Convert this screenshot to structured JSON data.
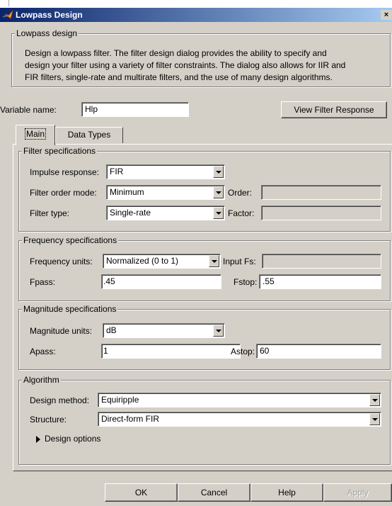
{
  "window": {
    "title": "Lowpass Design",
    "close_glyph": "×",
    "title_icon": "matlab-icon"
  },
  "intro": {
    "group_label": "Lowpass design",
    "description_lines": [
      "Design a lowpass filter.  The filter design dialog provides the ability to specify and",
      "design your filter using a variety of filter constraints.  The dialog also allows for IIR and",
      "FIR filters, single-rate and multirate filters, and the use of many design algorithms."
    ]
  },
  "variable": {
    "label": "Variable name:",
    "value": "Hlp",
    "view_button": "View Filter Response"
  },
  "tabs": [
    {
      "label": "Main",
      "active": true
    },
    {
      "label": "Data Types",
      "active": false
    }
  ],
  "filter_specs": {
    "group_label": "Filter specifications",
    "impulse_label": "Impulse response:",
    "impulse_value": "FIR",
    "order_mode_label": "Filter order mode:",
    "order_mode_value": "Minimum",
    "order_label": "Order:",
    "order_value": "",
    "type_label": "Filter type:",
    "type_value": "Single-rate",
    "factor_label": "Factor:",
    "factor_value": ""
  },
  "freq_specs": {
    "group_label": "Frequency specifications",
    "units_label": "Frequency units:",
    "units_value": "Normalized (0 to 1)",
    "input_fs_label": "Input Fs:",
    "input_fs_value": "",
    "fpass_label": "Fpass:",
    "fpass_value": ".45",
    "fstop_label": "Fstop:",
    "fstop_value": ".55"
  },
  "mag_specs": {
    "group_label": "Magnitude specifications",
    "units_label": "Magnitude units:",
    "units_value": "dB",
    "apass_label": "Apass:",
    "apass_value": "1",
    "astop_label": "Astop:",
    "astop_value": "60"
  },
  "algorithm": {
    "group_label": "Algorithm",
    "method_label": "Design method:",
    "method_value": "Equiripple",
    "structure_label": "Structure:",
    "structure_value": "Direct-form FIR",
    "options_label": "Design options"
  },
  "buttons": {
    "ok": "OK",
    "cancel": "Cancel",
    "help": "Help",
    "apply": "Apply"
  },
  "colors": {
    "title_start": "#0a246a",
    "title_end": "#a6caf0",
    "face": "#d4d0c8"
  }
}
